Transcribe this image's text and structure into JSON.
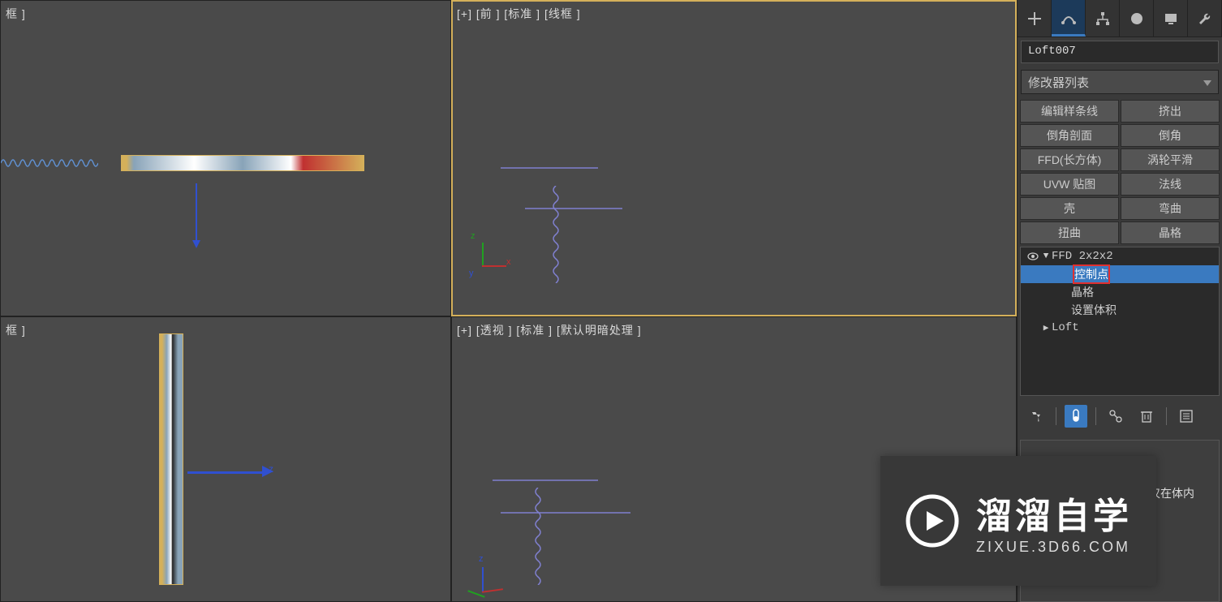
{
  "viewports": {
    "top_left": {
      "label": "框 ]"
    },
    "top_right": {
      "label": "[+] [前 ] [标准 ] [线框 ]"
    },
    "bottom_left": {
      "label": "框 ]"
    },
    "bottom_right": {
      "label": "[+] [透视 ] [标准 ] [默认明暗处理 ]"
    }
  },
  "command_panel": {
    "object_name": "Loft007",
    "modifier_dropdown": "修改器列表",
    "preset_buttons": [
      {
        "label": "编辑样条线"
      },
      {
        "label": "挤出"
      },
      {
        "label": "倒角剖面"
      },
      {
        "label": "倒角"
      },
      {
        "label": "FFD(长方体)"
      },
      {
        "label": "涡轮平滑"
      },
      {
        "label": "UVW 贴图"
      },
      {
        "label": "法线"
      },
      {
        "label": "壳"
      },
      {
        "label": "弯曲"
      },
      {
        "label": "扭曲"
      },
      {
        "label": "晶格"
      }
    ],
    "stack": {
      "top": "FFD 2x2x2",
      "sub1": "控制点",
      "sub2": "晶格",
      "sub3": "设置体积",
      "loft": "Loft"
    },
    "rollout_radio_fragment": "仅在体内"
  },
  "watermark": {
    "cn": "溜溜自学",
    "en": "ZIXUE.3D66.COM"
  },
  "colors": {
    "accent_blue": "#3a7ac0",
    "highlight_frame": "#d4b05a",
    "highlight_red": "#e03030"
  }
}
